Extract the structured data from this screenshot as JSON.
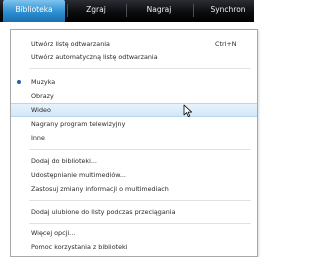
{
  "tabs": [
    "Biblioteka",
    "Zgraj",
    "Nagraj",
    "Synchron"
  ],
  "menu": {
    "items": [
      {
        "label": "Utwórz listę odtwarzania",
        "shortcut": "Ctrl+N"
      },
      {
        "label": "Utwórz automatyczną listę odtwarzania"
      },
      {
        "label": "Muzyka",
        "checked": true
      },
      {
        "label": "Obrazy"
      },
      {
        "label": "Wideo",
        "highlighted": true
      },
      {
        "label": "Nagrany program telewizyjny"
      },
      {
        "label": "Inne"
      },
      {
        "label": "Dodaj do biblioteki..."
      },
      {
        "label": "Udostępnianie multimediów..."
      },
      {
        "label": "Zastosuj zmiany informacji o multimediach"
      },
      {
        "label": "Dodaj ulubione do listy podczas przeciągania"
      },
      {
        "label": "Więcej opcji..."
      },
      {
        "label": "Pomoc korzystania z biblioteki"
      }
    ]
  },
  "colors": {
    "accent": "#2c8fd1",
    "highlight": "#dcecf9",
    "check": "#2a5fa8"
  },
  "icons": {
    "check": "radio-dot-icon",
    "cursor": "mouse-pointer-icon"
  }
}
